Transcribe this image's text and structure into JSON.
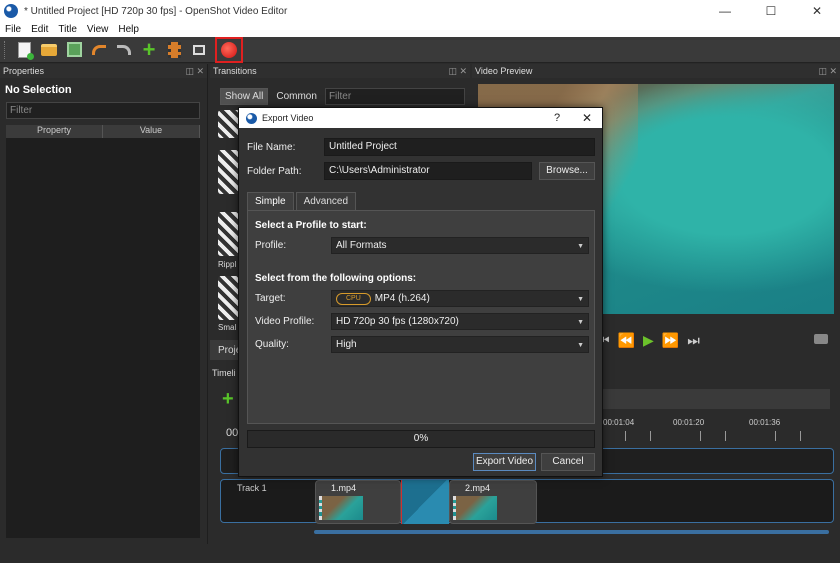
{
  "window": {
    "title": "* Untitled Project [HD 720p 30 fps] - OpenShot Video Editor",
    "minimize": "—",
    "maximize": "☐",
    "close": "✕"
  },
  "menu": [
    "File",
    "Edit",
    "Title",
    "View",
    "Help"
  ],
  "toolbar": {
    "icons": [
      "new-project-icon",
      "open-project-icon",
      "save-project-icon",
      "undo-icon",
      "redo-icon",
      "import-files-icon",
      "profile-icon",
      "fullscreen-icon",
      "export-video-icon"
    ],
    "highlighted": "export-video-icon",
    "highlight_color": "#e02020"
  },
  "properties": {
    "title": "Properties",
    "no_selection": "No Selection",
    "filter_placeholder": "Filter",
    "col_property": "Property",
    "col_value": "Value"
  },
  "transitions": {
    "title": "Transitions",
    "show_all": "Show All",
    "common": "Common",
    "filter_placeholder": "Filter",
    "thumb_labels": [
      "Rippl",
      "Smal"
    ],
    "tab_partial": "Proje",
    "timeline_partial": "Timeli",
    "time_partial": "00"
  },
  "preview": {
    "title": "Video Preview"
  },
  "timeline": {
    "ticks": [
      "00:01:04",
      "00:01:20",
      "00:01:36"
    ],
    "track_name": "Track 1",
    "clips": [
      "1.mp4",
      "2.mp4"
    ],
    "accent": "#3a6fa0"
  },
  "dialog": {
    "title": "Export Video",
    "help": "?",
    "close": "✕",
    "file_name_label": "File Name:",
    "file_name_value": "Untitled Project",
    "folder_path_label": "Folder Path:",
    "folder_path_value": "C:\\Users\\Administrator",
    "browse": "Browse...",
    "tab_simple": "Simple",
    "tab_advanced": "Advanced",
    "select_profile_heading": "Select a Profile to start:",
    "profile_label": "Profile:",
    "profile_value": "All Formats",
    "options_heading": "Select from the following options:",
    "target_label": "Target:",
    "target_badge": "CPU",
    "target_value": "MP4 (h.264)",
    "video_profile_label": "Video Profile:",
    "video_profile_value": "HD 720p 30 fps (1280x720)",
    "quality_label": "Quality:",
    "quality_value": "High",
    "progress_text": "0%",
    "progress_value": 0,
    "export_button": "Export Video",
    "cancel_button": "Cancel"
  }
}
